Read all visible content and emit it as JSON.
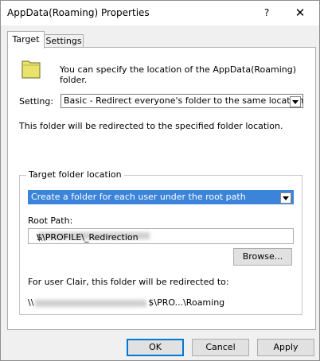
{
  "window": {
    "title": "AppData(Roaming) Properties",
    "help_label": "?",
    "close_label": "✕"
  },
  "tabs": [
    {
      "label": "Target",
      "selected": true
    },
    {
      "label": "Settings",
      "selected": false
    }
  ],
  "target": {
    "info_text": "You can specify the location of the AppData(Roaming) folder.",
    "setting_label": "Setting:",
    "setting_value": "Basic - Redirect everyone's folder to the same location",
    "redirect_text": "This folder will be redirected to the specified folder location.",
    "group": {
      "label": "Target folder location",
      "folder_option": "Create a folder for each user under the root path",
      "root_path_label": "Root Path:",
      "root_path_prefix": "\\\\",
      "root_path_suffix": "$\\PROFILE\\_Redirection",
      "browse_label": "Browse...",
      "preview_label": "For user Clair, this folder will be redirected to:",
      "preview_prefix": "\\\\",
      "preview_suffix": "$\\PRO...\\Roaming"
    }
  },
  "buttons": {
    "ok": "OK",
    "cancel": "Cancel",
    "apply": "Apply"
  },
  "colors": {
    "selection": "#3b84d9",
    "folder": "#e8e36a",
    "default_button_border": "#0078d7"
  },
  "icons": {
    "folder": "folder-icon"
  }
}
